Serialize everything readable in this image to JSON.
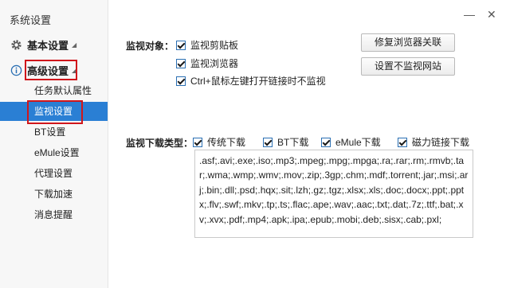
{
  "window": {
    "title": "系统设置",
    "minimize": "—",
    "close": "✕"
  },
  "sidebar": {
    "basic": {
      "label": "基本设置",
      "icon": "gear-icon"
    },
    "advanced": {
      "label": "高级设置",
      "icon": "info-icon"
    },
    "items": [
      {
        "label": "任务默认属性"
      },
      {
        "label": "监视设置",
        "selected": true
      },
      {
        "label": "BT设置"
      },
      {
        "label": "eMule设置"
      },
      {
        "label": "代理设置"
      },
      {
        "label": "下载加速"
      },
      {
        "label": "消息提醒"
      }
    ]
  },
  "monitor_object": {
    "label": "监视对象：",
    "options": [
      {
        "label": "监视剪贴板",
        "checked": true
      },
      {
        "label": "监视浏览器",
        "checked": true
      },
      {
        "label": "Ctrl+鼠标左键打开链接时不监视",
        "checked": true
      }
    ],
    "buttons": {
      "repair": "修复浏览器关联",
      "no_monitor_sites": "设置不监视网站"
    }
  },
  "download_types": {
    "label": "监视下载类型：",
    "options": [
      {
        "label": "传统下载",
        "checked": true
      },
      {
        "label": "BT下载",
        "checked": true
      },
      {
        "label": "eMule下载",
        "checked": true
      },
      {
        "label": "磁力链接下载",
        "checked": true
      }
    ],
    "extensions": ".asf;.avi;.exe;.iso;.mp3;.mpeg;.mpg;.mpga;.ra;.rar;.rm;.rmvb;.tar;.wma;.wmp;.wmv;.mov;.zip;.3gp;.chm;.mdf;.torrent;.jar;.msi;.arj;.bin;.dll;.psd;.hqx;.sit;.lzh;.gz;.tgz;.xlsx;.xls;.doc;.docx;.ppt;.pptx;.flv;.swf;.mkv;.tp;.ts;.flac;.ape;.wav;.aac;.txt;.dat;.7z;.ttf;.bat;.xv;.xvx;.pdf;.mp4;.apk;.ipa;.epub;.mobi;.deb;.sisx;.cab;.pxl;"
  },
  "colors": {
    "accent": "#2a7fd4",
    "highlight_box": "#d0161b",
    "checkbox_border": "#2a6fb3"
  }
}
